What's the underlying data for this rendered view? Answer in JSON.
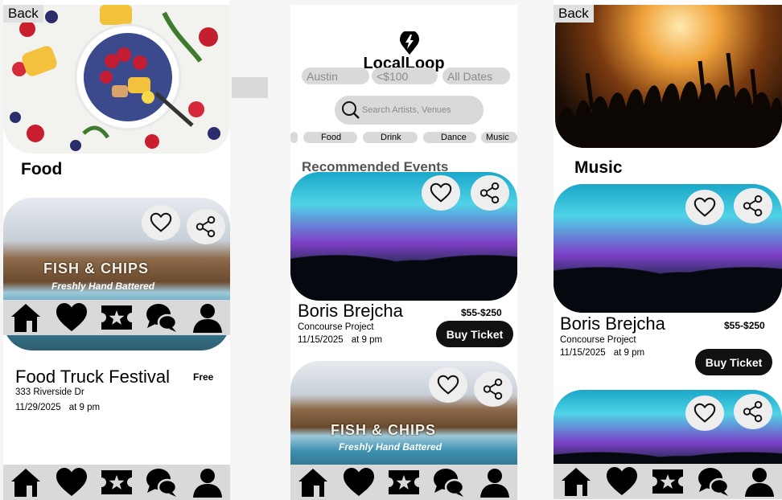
{
  "left": {
    "back": "Back",
    "section": "Food",
    "event": {
      "title": "Food Truck Festival",
      "price": "Free",
      "address": "333 Riverside Dr",
      "date": "11/29/2025",
      "time": "at 9 pm"
    },
    "card_sign": "FISH & CHIPS",
    "card_sub": "Freshly Hand Battered"
  },
  "mid": {
    "logo": "LocalLoop",
    "filters": {
      "location": "Austin",
      "price": "<$100",
      "dates": "All Dates"
    },
    "search_placeholder": "Search Artists, Venues",
    "categories": [
      "Food",
      "Drink",
      "Dance",
      "Music"
    ],
    "section": "Recommended Events",
    "event": {
      "title": "Boris Brejcha",
      "price": "$55-$250",
      "venue": "Concourse Project",
      "date": "11/15/2025",
      "time": "at 9 pm",
      "buy": "Buy Ticket"
    },
    "card_sign": "FISH & CHIPS",
    "card_sub": "Freshly Hand Battered"
  },
  "right": {
    "back": "Back",
    "section": "Music",
    "event": {
      "title": "Boris Brejcha",
      "price": "$55-$250",
      "venue": "Concourse Project",
      "date": "11/15/2025",
      "time": "at 9 pm",
      "buy": "Buy Ticket"
    }
  },
  "nav_icons": [
    "home-icon",
    "heart-icon",
    "ticket-icon",
    "chat-icon",
    "profile-icon"
  ]
}
